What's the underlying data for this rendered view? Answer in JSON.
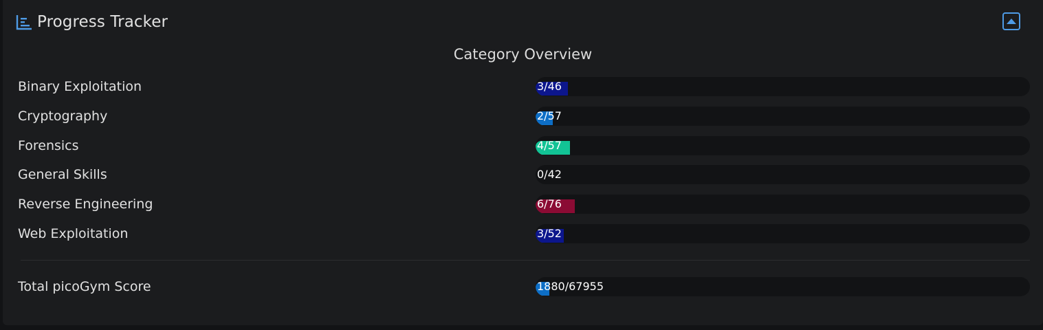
{
  "header": {
    "title": "Progress Tracker",
    "icon": "bar-chart-icon",
    "collapse_icon": "caret-up-icon"
  },
  "section_title": "Category Overview",
  "categories": [
    {
      "label": "Binary Exploitation",
      "value": "3/46",
      "solved": 3,
      "total": 46,
      "color": "#0c168c"
    },
    {
      "label": "Cryptography",
      "value": "2/57",
      "solved": 2,
      "total": 57,
      "color": "#0d6ec6"
    },
    {
      "label": "Forensics",
      "value": "4/57",
      "solved": 4,
      "total": 57,
      "color": "#12c395"
    },
    {
      "label": "General Skills",
      "value": "0/42",
      "solved": 0,
      "total": 42,
      "color": "#aaaaaa"
    },
    {
      "label": "Reverse Engineering",
      "value": "6/76",
      "solved": 6,
      "total": 76,
      "color": "#8b0b34"
    },
    {
      "label": "Web Exploitation",
      "value": "3/52",
      "solved": 3,
      "total": 52,
      "color": "#0c168c"
    }
  ],
  "total": {
    "label": "Total picoGym Score",
    "value": "1880/67955",
    "score": 1880,
    "max": 67955,
    "color": "#0d6ec6"
  },
  "colors": {
    "accent": "#4e9be6",
    "card": "#1b1c1e",
    "track": "#121315"
  }
}
